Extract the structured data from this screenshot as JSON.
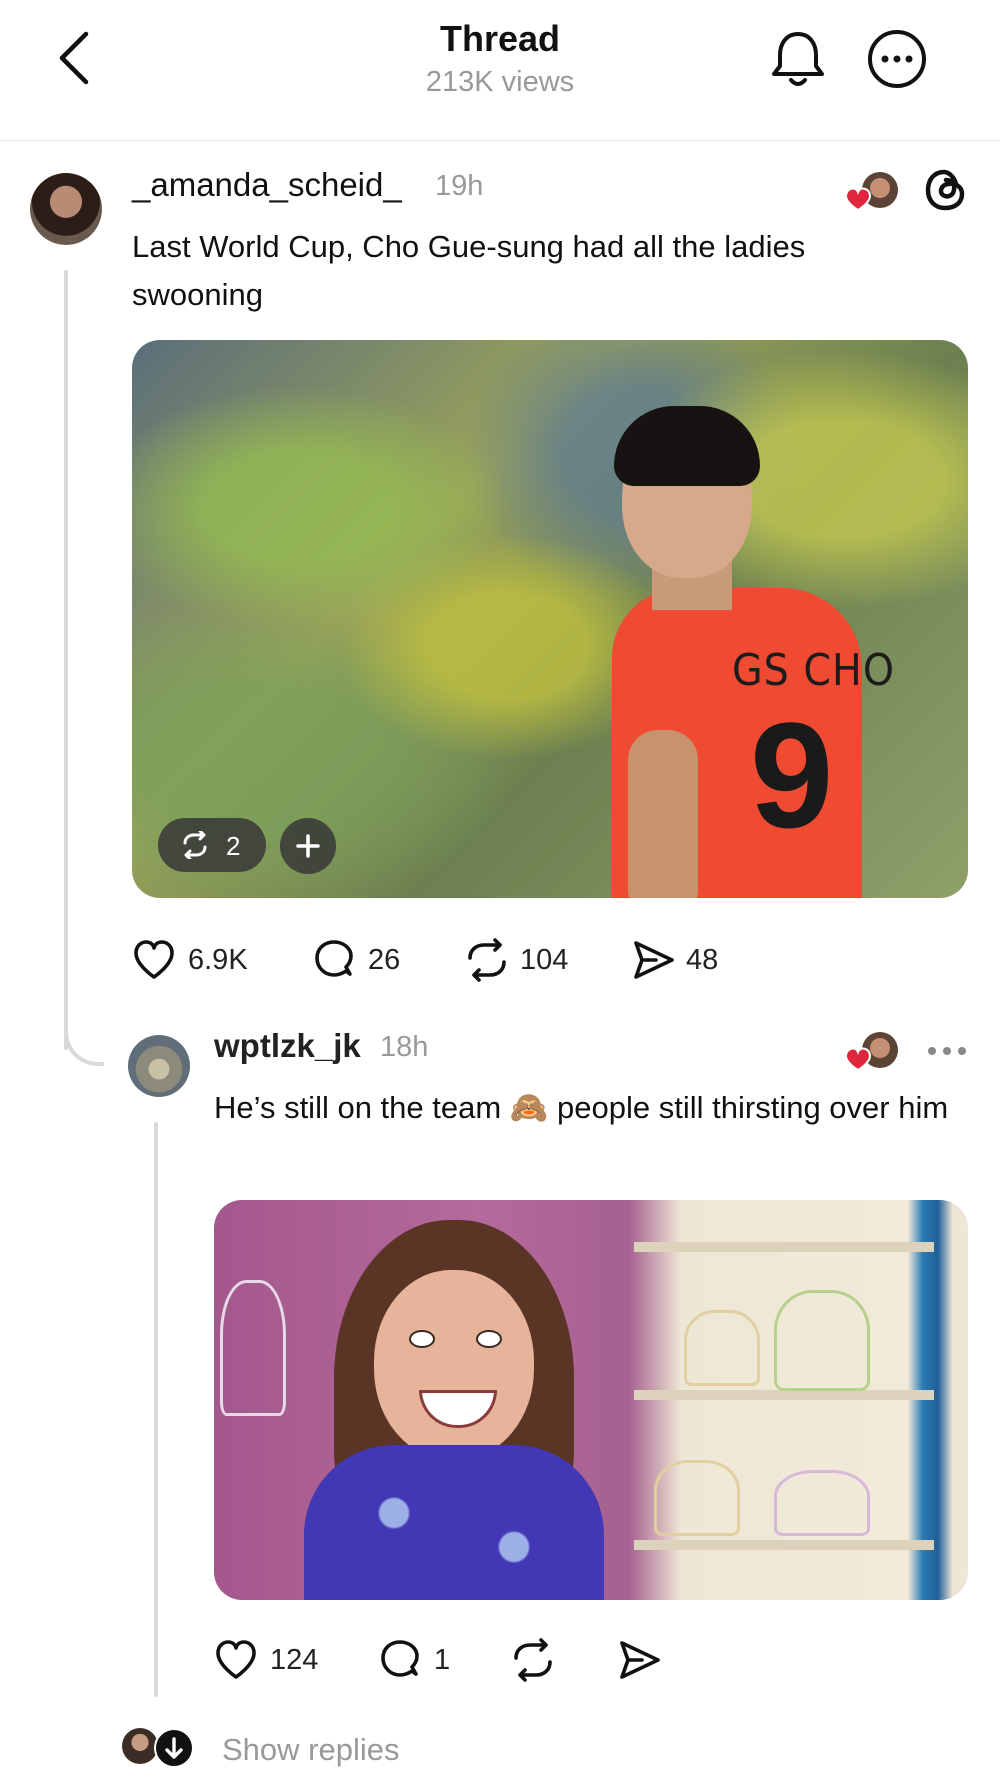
{
  "header": {
    "title": "Thread",
    "views": "213K views",
    "icons": [
      "chevron-left-icon",
      "bell-icon",
      "more-horizontal-icon"
    ]
  },
  "posts": [
    {
      "username": "_amanda_scheid_",
      "time": "19h",
      "text": "Last World Cup, Cho Gue-sung had all the ladies swooning",
      "image": {
        "jersey_name": "GS CHO",
        "jersey_number": "9",
        "repost_count": "2"
      },
      "actions": {
        "likes": "6.9K",
        "replies": "26",
        "reposts": "104",
        "shares": "48"
      }
    },
    {
      "username": "wptlzk_jk",
      "time": "18h",
      "text_before_emoji": "He’s still on the team",
      "emoji": "🙈",
      "text_after_emoji": "people still thirsting over him",
      "actions": {
        "likes": "124",
        "replies": "1"
      }
    }
  ],
  "show_replies": "Show replies",
  "colors": {
    "secondary_text": "#999999",
    "thread_line": "#d9d9d9",
    "like_red": "#e0263d",
    "jersey_red": "#ef4a32"
  }
}
